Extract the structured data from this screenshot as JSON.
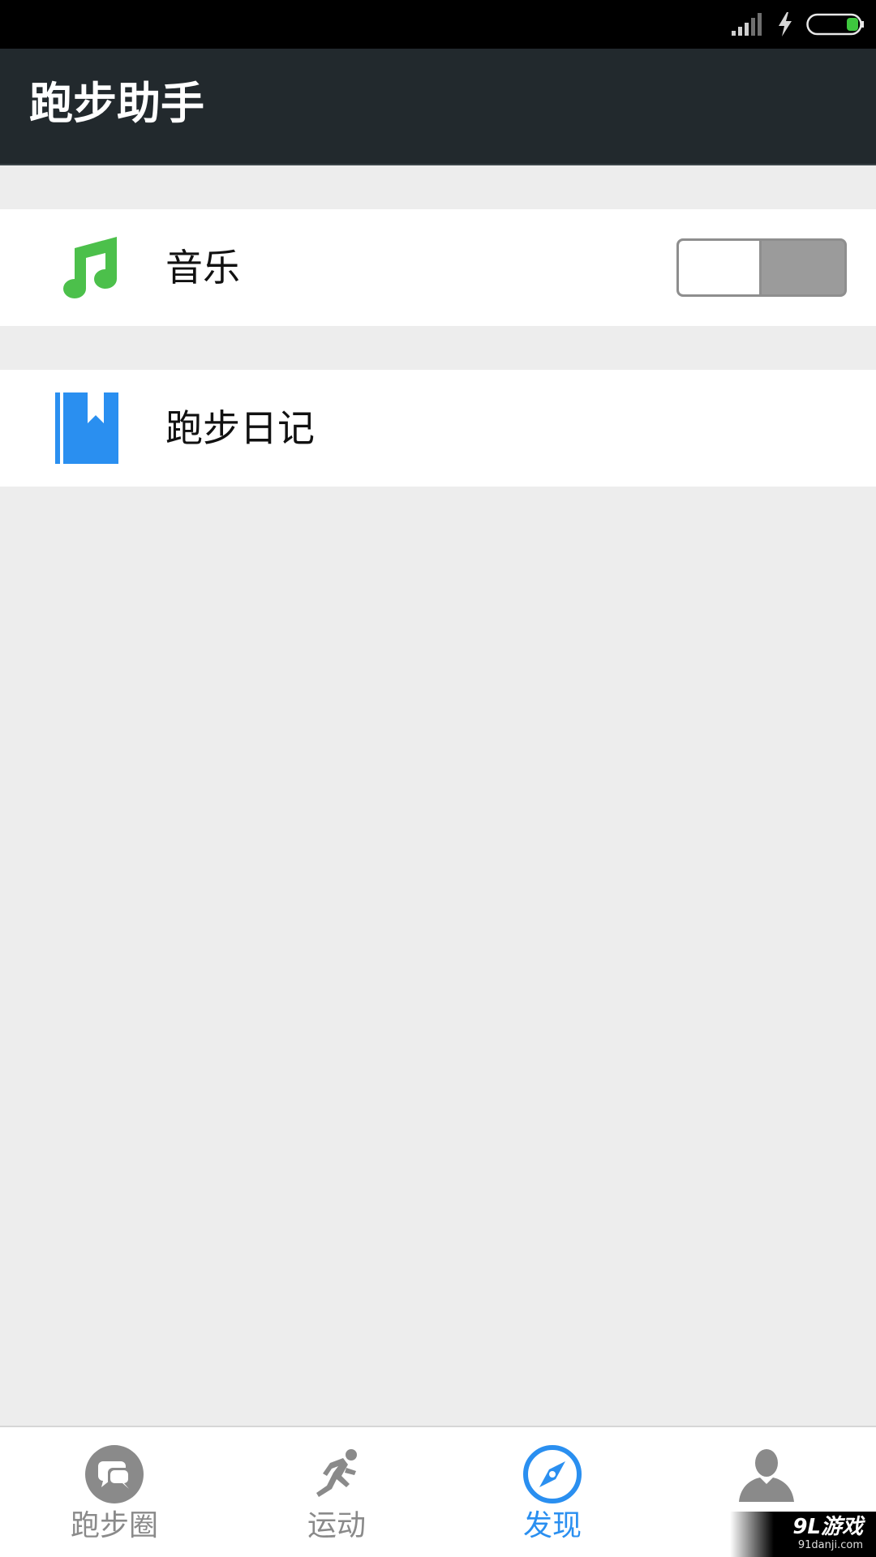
{
  "status_bar": {
    "signal_icon": "signal-icon",
    "charge_icon": "charging-bolt-icon",
    "battery_icon": "battery-icon"
  },
  "app_bar": {
    "title": "跑步助手"
  },
  "rows": {
    "music": {
      "label": "音乐",
      "icon": "music-note-icon",
      "icon_color": "#4cc04b",
      "toggle_on": false
    },
    "diary": {
      "label": "跑步日记",
      "icon": "bookmark-book-icon",
      "icon_color": "#2a8ff0"
    }
  },
  "bottom_nav": {
    "items": [
      {
        "label": "跑步圈",
        "icon": "chat-bubble-icon",
        "active": false
      },
      {
        "label": "运动",
        "icon": "runner-icon",
        "active": false
      },
      {
        "label": "发现",
        "icon": "compass-icon",
        "active": true
      },
      {
        "label": "",
        "icon": "user-icon",
        "active": false
      }
    ],
    "active_color": "#2a8ff0",
    "inactive_color": "#8a8a8a"
  },
  "watermark": {
    "logo": "9L游戏",
    "url": "91danji.com"
  }
}
